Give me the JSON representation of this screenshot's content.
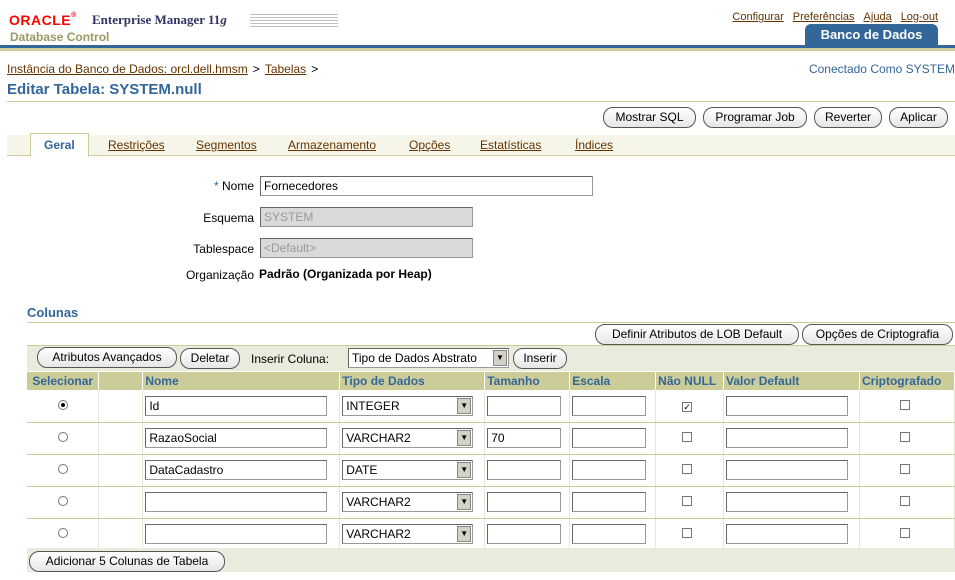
{
  "header": {
    "oracle": "ORACLE",
    "product": "Enterprise Manager 11",
    "product_g": "g",
    "subtitle": "Database Control",
    "links": [
      "Configurar",
      "Preferências",
      "Ajuda",
      "Log-out"
    ],
    "main_tab": "Banco de Dados"
  },
  "breadcrumb": {
    "items": [
      "Instância do Banco de Dados: orcl.dell.hmsm",
      "Tabelas"
    ],
    "separator": ">",
    "connected": "Conectado Como SYSTEM"
  },
  "page_title": "Editar Tabela: SYSTEM.null",
  "actions": [
    "Mostrar SQL",
    "Programar Job",
    "Reverter",
    "Aplicar"
  ],
  "tabs": [
    "Geral",
    "Restrições",
    "Segmentos",
    "Armazenamento",
    "Opções",
    "Estatísticas",
    "Índices"
  ],
  "form": {
    "required_mark": "*",
    "name_label": "Nome",
    "name_value": "Fornecedores",
    "schema_label": "Esquema",
    "schema_value": "SYSTEM",
    "tablespace_label": "Tablespace",
    "tablespace_value": "<Default>",
    "org_label": "Organização",
    "org_value": "Padrão (Organizada por Heap)"
  },
  "columns": {
    "title": "Colunas",
    "lob_button": "Definir Atributos de LOB Default",
    "crypto_button": "Opções de Criptografia",
    "advanced_button": "Atributos Avançados",
    "delete_button": "Deletar",
    "insert_label": "Inserir Coluna:",
    "insert_select": "Tipo de Dados Abstrato",
    "insert_button": "Inserir",
    "headers": [
      "Selecionar",
      "",
      "Nome",
      "Tipo de Dados",
      "Tamanho",
      "Escala",
      "Não NULL",
      "Valor Default",
      "Criptografado"
    ],
    "rows": [
      {
        "selected": true,
        "name": "Id",
        "type": "INTEGER",
        "size": "",
        "scale": "",
        "not_null": true,
        "default": "",
        "encrypted": false
      },
      {
        "selected": false,
        "name": "RazaoSocial",
        "type": "VARCHAR2",
        "size": "70",
        "scale": "",
        "not_null": false,
        "default": "",
        "encrypted": false
      },
      {
        "selected": false,
        "name": "DataCadastro",
        "type": "DATE",
        "size": "",
        "scale": "",
        "not_null": false,
        "default": "",
        "encrypted": false
      },
      {
        "selected": false,
        "name": "",
        "type": "VARCHAR2",
        "size": "",
        "scale": "",
        "not_null": false,
        "default": "",
        "encrypted": false
      },
      {
        "selected": false,
        "name": "",
        "type": "VARCHAR2",
        "size": "",
        "scale": "",
        "not_null": false,
        "default": "",
        "encrypted": false
      }
    ],
    "add_button": "Adicionar 5 Colunas de Tabela"
  }
}
